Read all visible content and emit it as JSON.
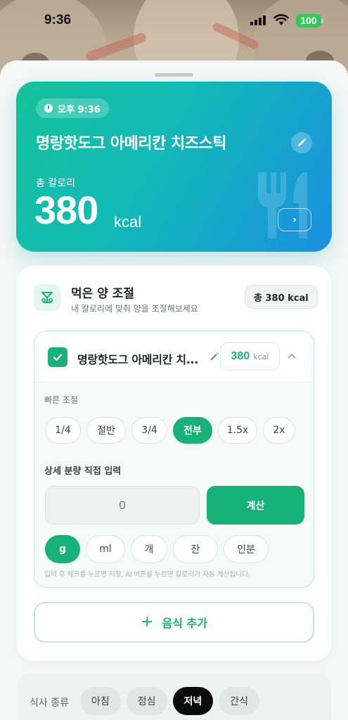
{
  "status_bar": {
    "time": "9:36",
    "battery": "100"
  },
  "hero": {
    "time": "오후 9:36",
    "title": "명랑핫도그 아메리칸 치즈스틱",
    "calorie_label": "총 칼로리",
    "calorie_value": "380",
    "calorie_unit": "kcal",
    "arrow": "›"
  },
  "portion_card": {
    "title": "먹은 양 조절",
    "subtitle": "내 칼로리에 맞춰 양을 조절해보세요",
    "total_badge": "총 380 kcal",
    "food": {
      "name": "명랑핫도그 아메리칸 치...",
      "calories": "380",
      "unit": "kcal",
      "quick_label": "빠른 조절",
      "quick_options": [
        "1/4",
        "절반",
        "3/4",
        "전부",
        "1.5x",
        "2x"
      ],
      "quick_selected": "전부",
      "detail_label": "상세 분량 직접 입력",
      "amount_placeholder": "0",
      "calc_label": "계산",
      "units": [
        "g",
        "ml",
        "개",
        "잔",
        "인분"
      ],
      "unit_selected": "g",
      "hint": "입력 후 체크를 누르면 저장, AI 버튼을 누르면 칼로리가 자동 계산됩니다."
    },
    "add_label": "음식 추가",
    "add_icon": "+"
  },
  "meal_type": {
    "label": "식사 종류",
    "options": [
      "아침",
      "점심",
      "저녁",
      "간식"
    ],
    "selected": "저녁"
  },
  "colors": {
    "accent": "#16b27a",
    "hero_start": "#15c29a",
    "hero_end": "#1a8fe0"
  }
}
